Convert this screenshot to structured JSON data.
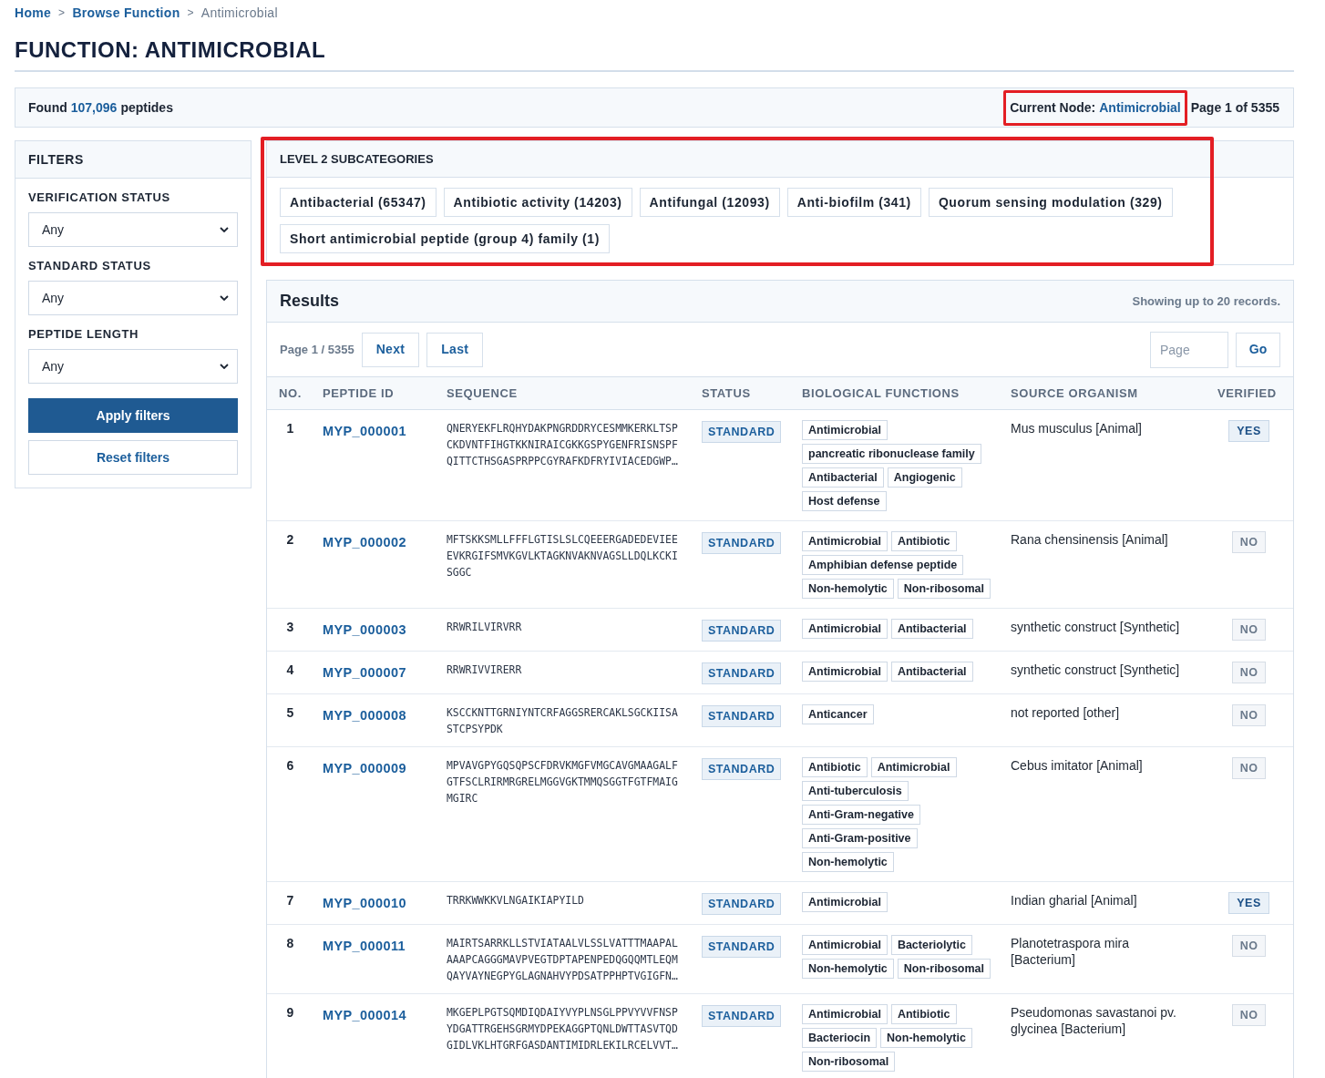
{
  "breadcrumb": {
    "items": [
      {
        "label": "Home",
        "current": false
      },
      {
        "label": "Browse Function",
        "current": false
      },
      {
        "label": "Antimicrobial",
        "current": true
      }
    ],
    "separators": [
      ">",
      ">"
    ]
  },
  "page_title": "FUNCTION: ANTIMICROBIAL",
  "summary": {
    "found_prefix": "Found",
    "found_count": "107,096",
    "found_suffix": "peptides",
    "current_node": {
      "label": "Current Node:",
      "value": "Antimicrobial",
      "highlighted": true
    },
    "page_info": "Page 1 of 5355"
  },
  "filters": {
    "title": "FILTERS",
    "groups": [
      {
        "label": "VERIFICATION STATUS",
        "value": "Any"
      },
      {
        "label": "STANDARD STATUS",
        "value": "Any"
      },
      {
        "label": "PEPTIDE LENGTH",
        "value": "Any"
      }
    ],
    "buttons": [
      {
        "label": "Apply filters",
        "kind": "primary"
      },
      {
        "label": "Reset filters",
        "kind": "secondary"
      }
    ]
  },
  "subcategories": {
    "title": "LEVEL 2 SUBCATEGORIES",
    "highlighted": true,
    "items": [
      "Antibacterial (65347)",
      "Antibiotic activity (14203)",
      "Antifungal (12093)",
      "Anti-biofilm (341)",
      "Quorum sensing modulation (329)",
      "Short antimicrobial peptide (group 4) family (1)"
    ]
  },
  "results": {
    "title": "Results",
    "note": "Showing up to 20 records.",
    "pager": {
      "label": "Page 1 / 5355",
      "buttons": [
        "Next",
        "Last"
      ],
      "page_input": {
        "placeholder": "Page"
      },
      "go": "Go"
    },
    "table": {
      "columns": [
        "NO.",
        "PEPTIDE ID",
        "SEQUENCE",
        "STATUS",
        "BIOLOGICAL FUNCTIONS",
        "SOURCE ORGANISM",
        "VERIFIED"
      ],
      "rows": [
        {
          "no": "1",
          "id": "MYP_000001",
          "sequence": "QNERYEKFLRQHYDAKPNGRDDRYCESMMKERKLTSPCKDVNTFIHGTKKNIRAICGKKGSPYGENFRISNSPFQITTCTHSGASPRPPCGYRAFKDFRYIVIACEDGWP…",
          "status": "STANDARD",
          "functions": [
            "Antimicrobial",
            "pancreatic ribonuclease family",
            "Antibacterial",
            "Angiogenic",
            "Host defense"
          ],
          "organism": "Mus musculus [Animal]",
          "verified": true,
          "verified_label": "YES"
        },
        {
          "no": "2",
          "id": "MYP_000002",
          "sequence": "MFTSKKSMLLFFFLGTISLSLCQEEERGADEDEVIEEEVKRGIFSMVKGVLKTAGKNVAKNVAGSLLDQLKCKISGGC",
          "status": "STANDARD",
          "functions": [
            "Antimicrobial",
            "Antibiotic",
            "Amphibian defense peptide",
            "Non-hemolytic",
            "Non-ribosomal"
          ],
          "organism": "Rana chensinensis [Animal]",
          "verified": false,
          "verified_label": "NO"
        },
        {
          "no": "3",
          "id": "MYP_000003",
          "sequence": "RRWRILVIRVRR",
          "status": "STANDARD",
          "functions": [
            "Antimicrobial",
            "Antibacterial"
          ],
          "organism": "synthetic construct [Synthetic]",
          "verified": false,
          "verified_label": "NO"
        },
        {
          "no": "4",
          "id": "MYP_000007",
          "sequence": "RRWRIVVIRERR",
          "status": "STANDARD",
          "functions": [
            "Antimicrobial",
            "Antibacterial"
          ],
          "organism": "synthetic construct [Synthetic]",
          "verified": false,
          "verified_label": "NO"
        },
        {
          "no": "5",
          "id": "MYP_000008",
          "sequence": "KSCCKNTTGRNIYNTCRFAGGSRERCAKLSGCKIISASTCPSYPDK",
          "status": "STANDARD",
          "functions": [
            "Anticancer"
          ],
          "organism": "not reported [other]",
          "verified": false,
          "verified_label": "NO"
        },
        {
          "no": "6",
          "id": "MYP_000009",
          "sequence": "MPVAVGPYGQSQPSCFDRVKMGFVMGCAVGMAAGALFGTFSCLRIRMRGRELMGGVGKTMMQSGGTFGTFMAIGMGIRC",
          "status": "STANDARD",
          "functions": [
            "Antibiotic",
            "Antimicrobial",
            "Anti-tuberculosis",
            "Anti-Gram-negative",
            "Anti-Gram-positive",
            "Non-hemolytic"
          ],
          "organism": "Cebus imitator [Animal]",
          "verified": false,
          "verified_label": "NO"
        },
        {
          "no": "7",
          "id": "MYP_000010",
          "sequence": "TRRKWWKKVLNGAIKIAPYILD",
          "status": "STANDARD",
          "functions": [
            "Antimicrobial"
          ],
          "organism": "Indian gharial [Animal]",
          "verified": true,
          "verified_label": "YES"
        },
        {
          "no": "8",
          "id": "MYP_000011",
          "sequence": "MAIRTSARRKLLSTVIATAALVLSSLVATTTMAAPALAAAPCAGGGMAVPVEGTDPTAPENPEDQGQQMTLEQMQAYVAYNEGPYGLAGNAHVYPDSATPPHPTVGIGFN…",
          "status": "STANDARD",
          "functions": [
            "Antimicrobial",
            "Bacteriolytic",
            "Non-hemolytic",
            "Non-ribosomal"
          ],
          "organism": "Planotetraspora mira [Bacterium]",
          "verified": false,
          "verified_label": "NO"
        },
        {
          "no": "9",
          "id": "MYP_000014",
          "sequence": "MKGEPLPGTSQMDIQDAIYVYPLNSGLPPVYVVFNSPYDGATTRGEHSGRMYDPEKAGGPTQNLDWTTASVTQDGIDLVKLHTGRFGASDANTIMIDRLEKILRCELVVT…",
          "status": "STANDARD",
          "functions": [
            "Antimicrobial",
            "Antibiotic",
            "Bacteriocin",
            "Non-hemolytic",
            "Non-ribosomal"
          ],
          "organism": "Pseudomonas savastanoi pv. glycinea [Bacterium]",
          "verified": false,
          "verified_label": "NO"
        }
      ]
    }
  }
}
